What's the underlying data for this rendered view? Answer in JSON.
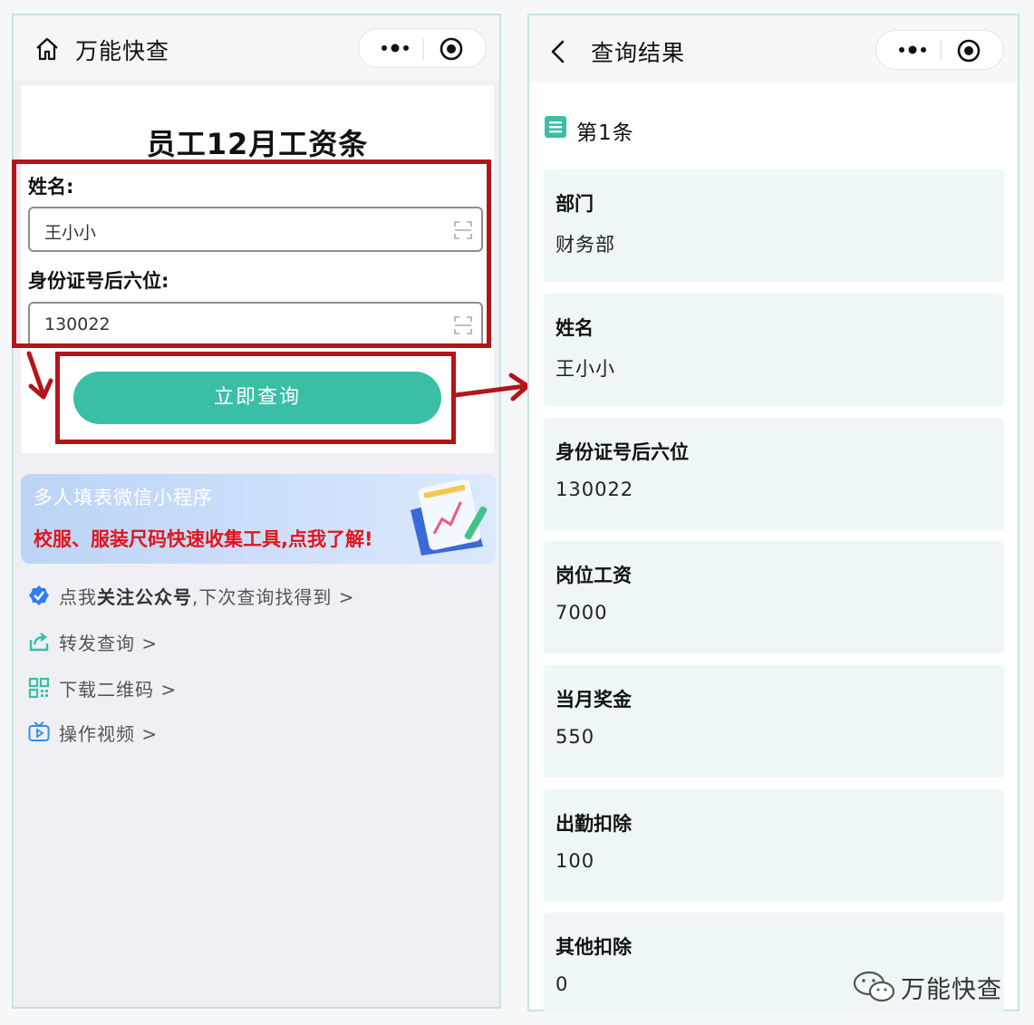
{
  "left": {
    "title": "万能快查",
    "form": {
      "title": "员工12月工资条",
      "name_label": "姓名:",
      "name_value": "王小小",
      "id_label": "身份证号后六位:",
      "id_value": "130022",
      "submit_label": "立即查询"
    },
    "banner": {
      "line1": "多人填表微信小程序",
      "line2": "校服、服装尺码快速收集工具,点我了解!"
    },
    "links": {
      "follow_pre": "点我",
      "follow_bold": "关注公众号",
      "follow_post": ",下次查询找得到 >",
      "share": "转发查询 >",
      "qrcode": "下载二维码 >",
      "video": "操作视频 >"
    }
  },
  "right": {
    "title": "查询结果",
    "record_label": "第1条",
    "fields": [
      {
        "key": "部门",
        "value": "财务部"
      },
      {
        "key": "姓名",
        "value": "王小小"
      },
      {
        "key": "身份证号后六位",
        "value": "130022"
      },
      {
        "key": "岗位工资",
        "value": "7000"
      },
      {
        "key": "当月奖金",
        "value": "550"
      },
      {
        "key": "出勤扣除",
        "value": "100"
      },
      {
        "key": "其他扣除",
        "value": "0"
      }
    ]
  },
  "watermark": "万能快查",
  "colors": {
    "accent": "#3abfa6",
    "annotation_red": "#b4141b",
    "banner_red": "#e3141d",
    "card_bg": "#eef6f8"
  },
  "icons": [
    "home-icon",
    "more-icon",
    "target-icon",
    "back-icon",
    "scan-icon",
    "verified-icon",
    "share-icon",
    "qrcode-icon",
    "video-icon",
    "list-icon",
    "wechat-icon"
  ]
}
